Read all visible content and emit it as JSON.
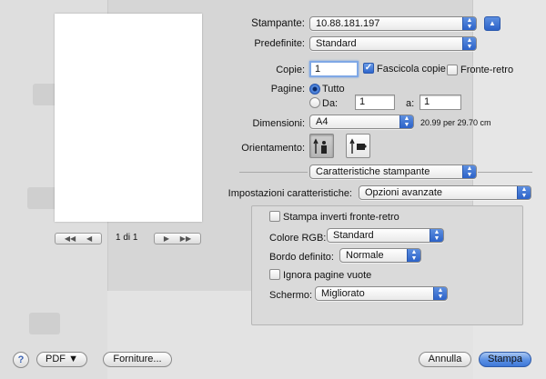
{
  "preview": {
    "page_indicator": "1 di 1"
  },
  "printer": {
    "label": "Stampante:",
    "value": "10.88.181.197"
  },
  "presets": {
    "label": "Predefinite:",
    "value": "Standard"
  },
  "copies": {
    "label": "Copie:",
    "value": "1",
    "collate_label": "Fascicola copie",
    "collate_checked": true,
    "duplex_label": "Fronte-retro",
    "duplex_checked": false
  },
  "pages": {
    "label": "Pagine:",
    "all_label": "Tutto",
    "from_label": "Da:",
    "from_value": "1",
    "to_label": "a:",
    "to_value": "1",
    "selected": "all"
  },
  "paper_size": {
    "label": "Dimensioni:",
    "value": "A4",
    "dimensions": "20.99 per 29.70 cm"
  },
  "orientation": {
    "label": "Orientamento:",
    "selected": "portrait"
  },
  "section_popup": {
    "value": "Caratteristiche stampante"
  },
  "feature_sets": {
    "label": "Impostazioni caratteristiche:",
    "value": "Opzioni avanzate"
  },
  "advanced": {
    "reverse_duplex_label": "Stampa inverti fronte-retro",
    "reverse_duplex_checked": false,
    "rgb_label": "Colore RGB:",
    "rgb_value": "Standard",
    "edge_label": "Bordo definito:",
    "edge_value": "Normale",
    "skip_blank_label": "Ignora pagine vuote",
    "skip_blank_checked": false,
    "screen_label": "Schermo:",
    "screen_value": "Migliorato"
  },
  "footer": {
    "help": "?",
    "pdf_label": "PDF ▼",
    "supplies_label": "Forniture...",
    "cancel_label": "Annulla",
    "print_label": "Stampa"
  },
  "colors": {
    "accent": "#3f78d8",
    "background": "#e3e3e3"
  }
}
